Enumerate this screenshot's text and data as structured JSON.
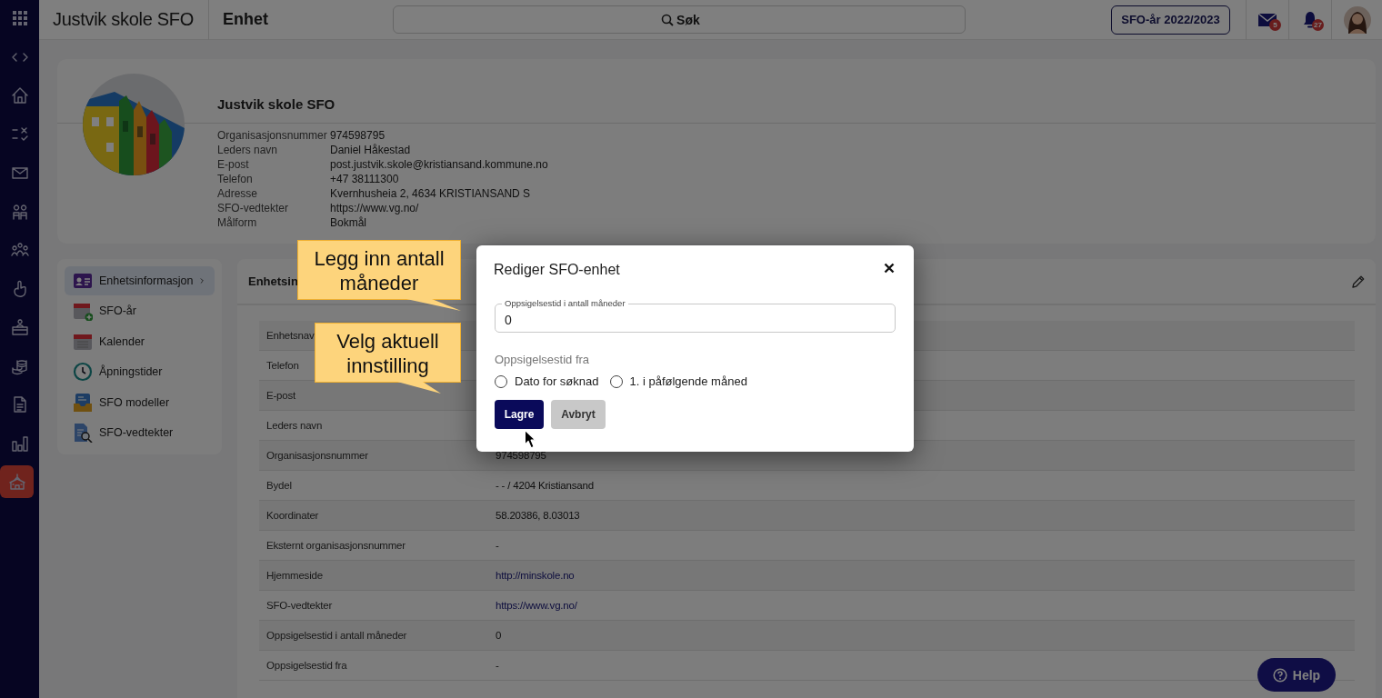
{
  "rail": {
    "items": [
      {
        "selected": false
      },
      {
        "selected": false
      },
      {
        "selected": false
      },
      {
        "selected": false
      },
      {
        "selected": false
      },
      {
        "selected": false
      },
      {
        "selected": false
      },
      {
        "selected": false
      },
      {
        "selected": false
      },
      {
        "selected": false
      },
      {
        "selected": false
      },
      {
        "selected": false
      },
      {
        "selected": true
      }
    ]
  },
  "topbar": {
    "app_title": "Justvik skole SFO",
    "page_title": "Enhet",
    "search": {
      "placeholder": "Søk"
    },
    "year_button": "SFO-år 2022/2023",
    "mail_badge": "5",
    "notification_badge": "27"
  },
  "profile": {
    "name": "Justvik skole SFO",
    "fields": [
      {
        "label": "Organisasjonsnummer",
        "value": "974598795"
      },
      {
        "label": "Leders navn",
        "value": "Daniel Håkestad"
      },
      {
        "label": "E-post",
        "value": "post.justvik.skole@kristiansand.kommune.no"
      },
      {
        "label": "Telefon",
        "value": "+47 38111300"
      },
      {
        "label": "Adresse",
        "value": "Kvernhusheia 2, 4634 KRISTIANSAND S"
      },
      {
        "label": "SFO-vedtekter",
        "value": "https://www.vg.no/"
      },
      {
        "label": "Målform",
        "value": "Bokmål"
      }
    ]
  },
  "side_menu": {
    "items": [
      {
        "label": "Enhetsinformasjon",
        "selected": true
      },
      {
        "label": "SFO-år",
        "selected": false
      },
      {
        "label": "Kalender",
        "selected": false
      },
      {
        "label": "Åpningstider",
        "selected": false
      },
      {
        "label": "SFO modeller",
        "selected": false
      },
      {
        "label": "SFO-vedtekter",
        "selected": false
      }
    ]
  },
  "panel": {
    "title": "Enhetsin",
    "rows": [
      {
        "label": "Enhetsnav"
      },
      {
        "label": "Telefon"
      },
      {
        "label": "E-post"
      },
      {
        "label": "Leders navn"
      },
      {
        "label": "Organisasjonsnummer",
        "value": "974598795",
        "link": false
      },
      {
        "label": "Bydel",
        "value": "- - / 4204 Kristiansand",
        "link": false
      },
      {
        "label": "Koordinater",
        "value": "58.20386, 8.03013",
        "link": false
      },
      {
        "label": "Eksternt organisasjonsnummer",
        "value": "-",
        "link": false
      },
      {
        "label": "Hjemmeside",
        "value": "http://minskole.no",
        "link": true
      },
      {
        "label": "SFO-vedtekter",
        "value": "https://www.vg.no/",
        "link": true
      },
      {
        "label": "Oppsigelsestid i antall måneder",
        "value": "0",
        "link": false
      },
      {
        "label": "Oppsigelsestid fra",
        "value": "-",
        "link": false
      }
    ]
  },
  "dialog": {
    "title": "Rediger SFO-enhet",
    "field": {
      "label": "Oppsigelsestid i antall måneder",
      "value": "0"
    },
    "radio_group": {
      "label": "Oppsigelsestid fra",
      "options": [
        {
          "label": "Dato for søknad",
          "selected": false
        },
        {
          "label": "1. i påfølgende måned",
          "selected": false
        }
      ]
    },
    "buttons": [
      {
        "label": "Lagre",
        "kind": "primary"
      },
      {
        "label": "Avbryt",
        "kind": "secondary"
      }
    ]
  },
  "callouts": [
    {
      "text": "Legg inn antall måneder"
    },
    {
      "text": "Velg aktuell innstilling"
    }
  ],
  "help_button": "Help"
}
